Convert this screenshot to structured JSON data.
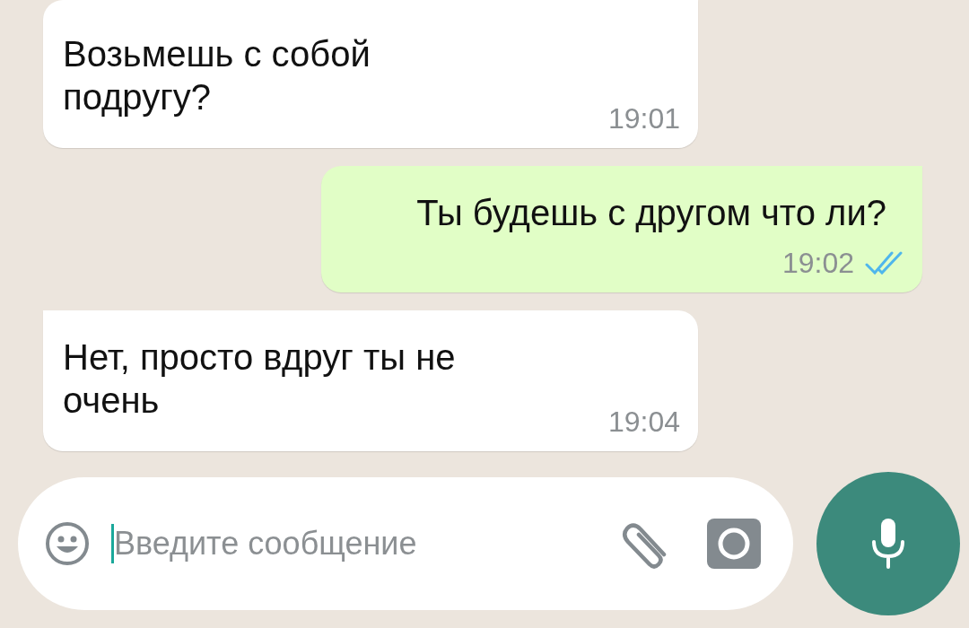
{
  "messages": [
    {
      "kind": "incoming",
      "text": "Возьмешь с собой подругу?",
      "time": "19:01",
      "tail": false
    },
    {
      "kind": "outgoing",
      "text": "Ты будешь с другом что ли?",
      "time": "19:02",
      "read": true,
      "tail": true
    },
    {
      "kind": "incoming",
      "text": "Нет, просто вдруг ты не очень",
      "time": "19:04",
      "tail": true
    }
  ],
  "composer": {
    "placeholder": "Введите сообщение"
  }
}
